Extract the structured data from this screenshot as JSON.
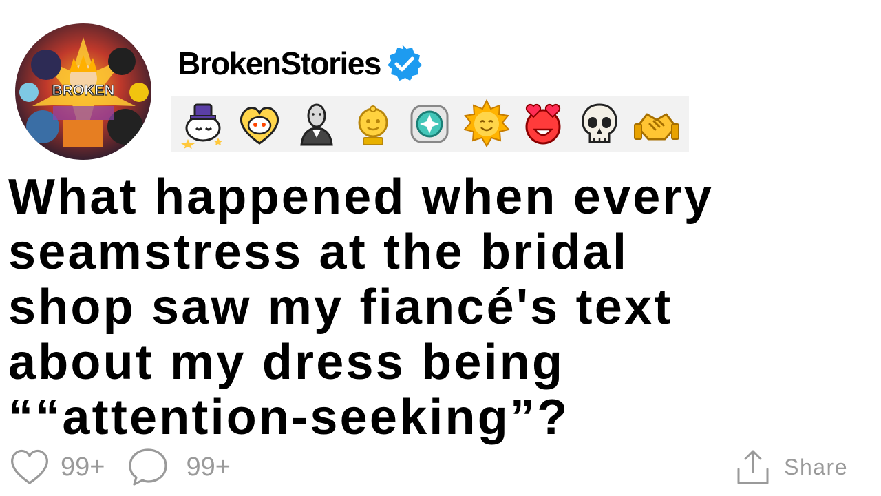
{
  "post": {
    "username": "BrokenStories",
    "verified_icon": "verified-badge-icon",
    "avatar": {
      "badge_text": "BROKEN"
    },
    "awards": [
      {
        "name": "sleepy-star-award-icon"
      },
      {
        "name": "heart-snoo-award-icon"
      },
      {
        "name": "bust-statue-award-icon"
      },
      {
        "name": "gold-snoo-award-icon"
      },
      {
        "name": "gem-award-icon"
      },
      {
        "name": "sun-face-award-icon"
      },
      {
        "name": "heart-eyes-award-icon"
      },
      {
        "name": "skull-award-icon"
      },
      {
        "name": "handshake-award-icon"
      }
    ],
    "title_lines": [
      "What happened when every",
      "seamstress at the bridal",
      "shop saw my fiancé's text",
      "about my dress being",
      "““attention-seeking”?"
    ],
    "likes": "99+",
    "comments": "99+",
    "share_label": "Share"
  },
  "colors": {
    "verified_blue": "#1d9bf0",
    "muted_grey": "#9a9a9a",
    "award_strip_bg": "#f2f2f2"
  }
}
